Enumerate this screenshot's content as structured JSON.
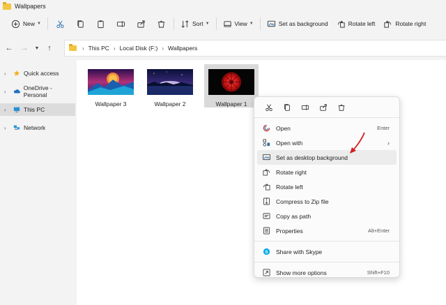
{
  "window": {
    "title": "Wallpapers"
  },
  "toolbar": {
    "new_label": "New",
    "sort_label": "Sort",
    "view_label": "View",
    "set_bg_label": "Set as background",
    "rotate_left_label": "Rotate left",
    "rotate_right_label": "Rotate right"
  },
  "address": {
    "crumbs": [
      "This PC",
      "Local Disk (F:)",
      "Wallpapers"
    ]
  },
  "sidebar": {
    "items": [
      {
        "label": "Quick access",
        "icon": "star-icon"
      },
      {
        "label": "OneDrive - Personal",
        "icon": "cloud-icon"
      },
      {
        "label": "This PC",
        "icon": "monitor-icon",
        "selected": true
      },
      {
        "label": "Network",
        "icon": "network-icon"
      }
    ]
  },
  "files": [
    {
      "name": "Wallpaper 3"
    },
    {
      "name": "Wallpaper 2"
    },
    {
      "name": "Wallpaper 1",
      "selected": true
    }
  ],
  "context_menu": {
    "items": [
      {
        "label": "Open",
        "shortcut": "Enter",
        "icon": "open-icon"
      },
      {
        "label": "Open with",
        "icon": "open-with-icon",
        "submenu": true
      },
      {
        "label": "Set as desktop background",
        "icon": "desktop-background-icon",
        "highlighted": true
      },
      {
        "label": "Rotate right",
        "icon": "rotate-right-icon"
      },
      {
        "label": "Rotate left",
        "icon": "rotate-left-icon"
      },
      {
        "label": "Compress to Zip file",
        "icon": "zip-icon"
      },
      {
        "label": "Copy as path",
        "icon": "copy-path-icon"
      },
      {
        "label": "Properties",
        "shortcut": "Alt+Enter",
        "icon": "properties-icon"
      },
      {
        "label": "Share with Skype",
        "icon": "skype-icon"
      },
      {
        "label": "Show more options",
        "shortcut": "Shift+F10",
        "icon": "more-options-icon"
      }
    ]
  },
  "colors": {
    "accent": "#0067c0",
    "annotation_arrow": "#d32020",
    "folder": "#f4c542"
  }
}
